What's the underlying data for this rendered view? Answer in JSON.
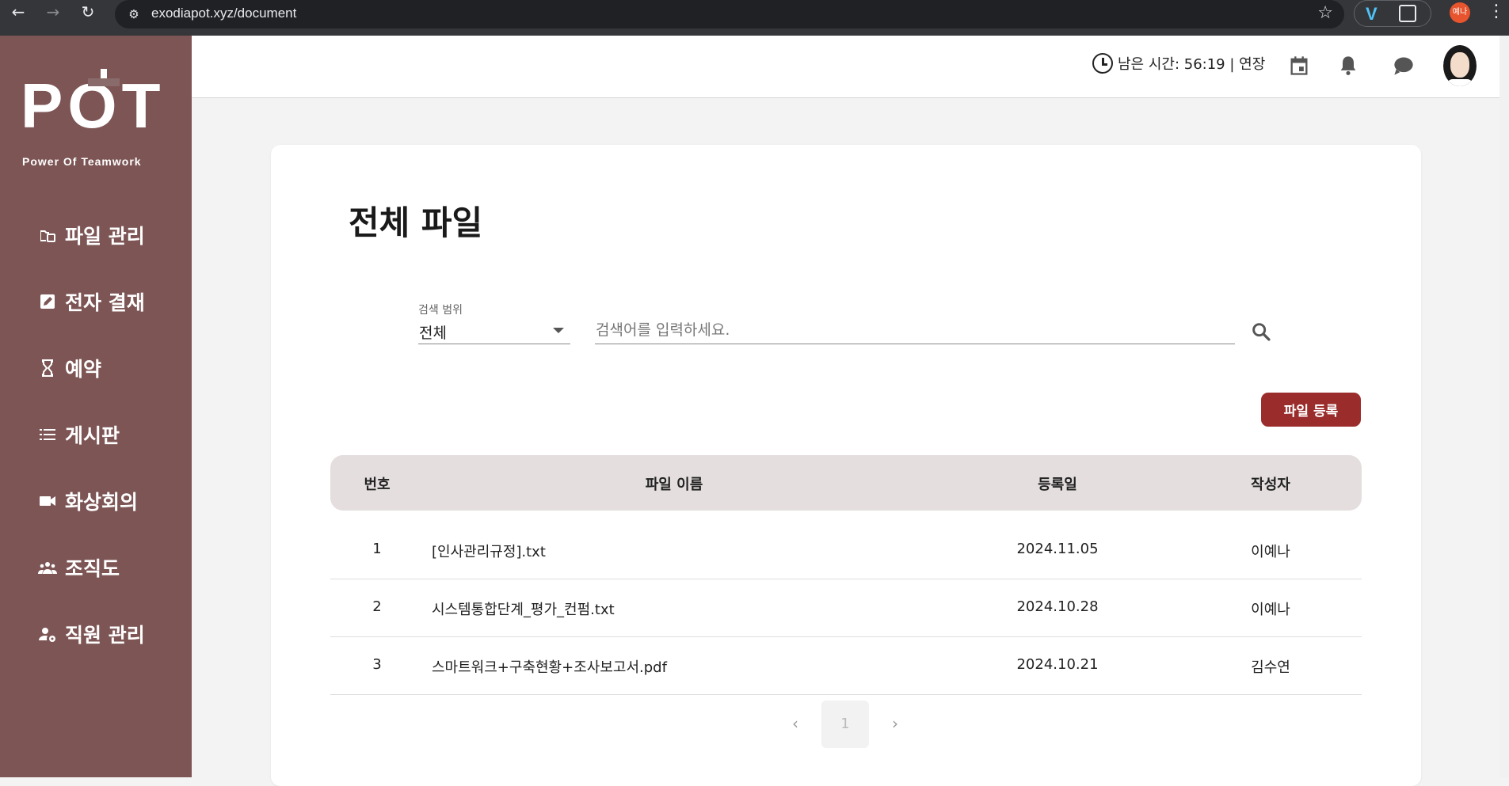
{
  "browser": {
    "url": "exodiapot.xyz/document",
    "profile_initials": "예나"
  },
  "logo": {
    "word": "POT",
    "tagline": "Power Of Teamwork"
  },
  "sidebar": {
    "items": [
      {
        "label": "파일 관리",
        "icon": "folder-icon"
      },
      {
        "label": "전자 결재",
        "icon": "edit-icon"
      },
      {
        "label": "예약",
        "icon": "hourglass-icon"
      },
      {
        "label": "게시판",
        "icon": "list-icon"
      },
      {
        "label": "화상회의",
        "icon": "videocam-icon"
      },
      {
        "label": "조직도",
        "icon": "people-icon"
      },
      {
        "label": "직원 관리",
        "icon": "manage-account-icon"
      }
    ]
  },
  "header": {
    "timer_text": "남은 시간: 56:19 | 연장"
  },
  "page": {
    "title": "전체 파일",
    "scope_label": "검색 범위",
    "scope_value": "전체",
    "search_placeholder": "검색어를 입력하세요.",
    "upload_label": "파일 등록"
  },
  "table": {
    "headers": [
      "번호",
      "파일 이름",
      "등록일",
      "작성자"
    ],
    "rows": [
      {
        "no": "1",
        "name": "[인사관리규정].txt",
        "date": "2024.11.05",
        "author": "이예나"
      },
      {
        "no": "2",
        "name": "시스템통합단계_평가_컨펌.txt",
        "date": "2024.10.28",
        "author": "이예나"
      },
      {
        "no": "3",
        "name": "스마트워크+구축현황+조사보고서.pdf",
        "date": "2024.10.21",
        "author": "김수연"
      }
    ]
  },
  "pagination": {
    "current": "1",
    "prev": "‹",
    "next": "›"
  },
  "colors": {
    "sidebar": "#7d5555",
    "primary_button": "#9b2c2c",
    "table_header": "#e4dede"
  }
}
